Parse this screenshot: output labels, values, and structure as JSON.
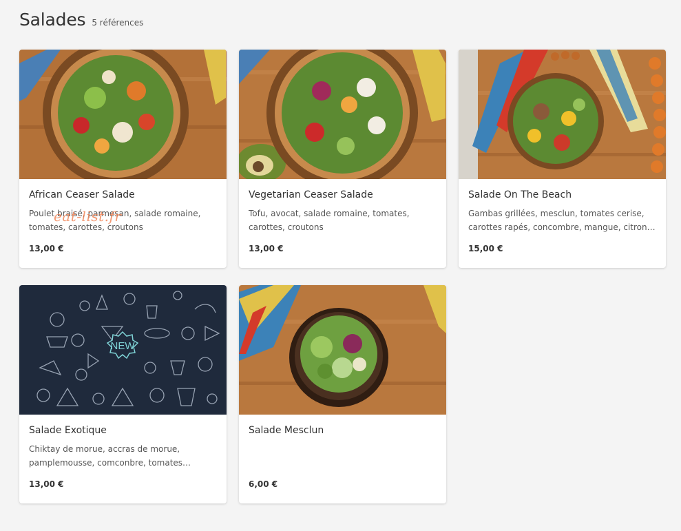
{
  "header": {
    "title": "Salades",
    "count": "5 références"
  },
  "cards": [
    {
      "name": "African Ceaser Salade",
      "description": "Poulet braisé, parmesan, salade romaine, tomates, carottes, croutons",
      "price": "13,00 €",
      "image": "salad-bowl-photo"
    },
    {
      "name": "Vegetarian Ceaser Salade",
      "description": "Tofu, avocat, salade romaine, tomates, carottes, croutons",
      "price": "13,00 €",
      "image": "salad-bowl-photo"
    },
    {
      "name": "Salade On The Beach",
      "description": "Gambas grillées, mesclun, tomates cerise, carottes rapés, concombre, mangue, citron…",
      "price": "15,00 €",
      "image": "salad-bowl-photo"
    },
    {
      "name": "Salade Exotique",
      "description": "Chiktay de morue, accras de morue, pamplemousse, comconbre, tomates…",
      "price": "13,00 €",
      "image": "new-placeholder",
      "badge": "NEW"
    },
    {
      "name": "Salade Mesclun",
      "description": "",
      "price": "6,00 €",
      "image": "salad-bowl-photo"
    }
  ],
  "watermark": "eat-list.fr",
  "colors": {
    "background": "#f4f4f4",
    "card": "#ffffff",
    "placeholder_bg": "#1f2a3c",
    "wood": "#b9783e",
    "watermark": "#f07846"
  }
}
